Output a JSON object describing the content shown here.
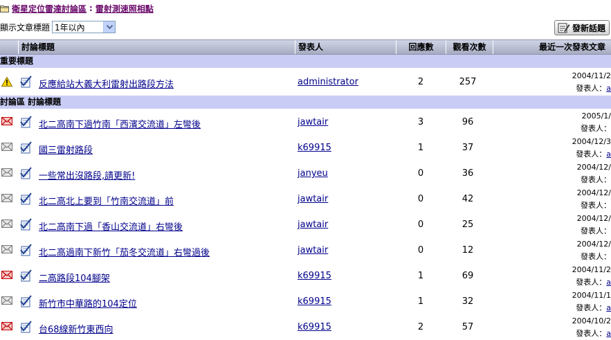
{
  "breadcrumb": {
    "forum": "衛星定位雷達討論區",
    "separator": ":",
    "board": "雷射測速照相點"
  },
  "filter": {
    "label": "顯示文章標題",
    "selected": "1年以內"
  },
  "new_topic_label": "發新話題",
  "columns": {
    "title": "討論標題",
    "poster": "發表人",
    "replies": "回應數",
    "views": "觀看次數",
    "last_post": "最近一次發表文章"
  },
  "sections": {
    "important": "重要標題",
    "discussion": "討論區 討論標題"
  },
  "last_by_label": "發表人：",
  "important_topics": [
    {
      "title": "反應給站大義大利雷射出路段方法",
      "poster": "administrator",
      "replies": "2",
      "views": "257",
      "last_date": "2004/11/2",
      "last_by": "a",
      "status": "warning"
    }
  ],
  "topics": [
    {
      "title": "北二高南下過竹南「西濱交流道」左彎後",
      "poster": "jawtair",
      "replies": "3",
      "views": "96",
      "last_date": "2005/1/",
      "last_by": "",
      "status": "hot"
    },
    {
      "title": "國三雷射路段",
      "poster": "k69915",
      "replies": "1",
      "views": "37",
      "last_date": "2004/12/3",
      "last_by": "a",
      "status": "normal"
    },
    {
      "title": "一些常出沒路段,請更新!",
      "poster": "janyeu",
      "replies": "0",
      "views": "36",
      "last_date": "2004/12/",
      "last_by": "",
      "status": "normal"
    },
    {
      "title": "北二高北上要到「竹南交流道」前",
      "poster": "jawtair",
      "replies": "0",
      "views": "42",
      "last_date": "2004/12/",
      "last_by": "",
      "status": "normal"
    },
    {
      "title": "北二高南下過「香山交流道」右彎後",
      "poster": "jawtair",
      "replies": "0",
      "views": "25",
      "last_date": "2004/12/",
      "last_by": "",
      "status": "normal"
    },
    {
      "title": "北二高過南下新竹「茄冬交流道」右彎過後",
      "poster": "jawtair",
      "replies": "0",
      "views": "12",
      "last_date": "2004/12/",
      "last_by": "",
      "status": "normal"
    },
    {
      "title": "二高路段104腳架",
      "poster": "k69915",
      "replies": "1",
      "views": "69",
      "last_date": "2004/11/2",
      "last_by": "a",
      "status": "hot"
    },
    {
      "title": "新竹市中華路的104定位",
      "poster": "k69915",
      "replies": "1",
      "views": "32",
      "last_date": "2004/11/1",
      "last_by": "a",
      "status": "normal"
    },
    {
      "title": "台68線新竹東西向",
      "poster": "k69915",
      "replies": "2",
      "views": "57",
      "last_date": "2004/10/2",
      "last_by": "a",
      "status": "hot"
    }
  ],
  "colors": {
    "section_bg": "#c9cdf5",
    "link": "#00008b",
    "breadcrumb": "#6a0a6a",
    "hot_envelope": "#d00000"
  }
}
